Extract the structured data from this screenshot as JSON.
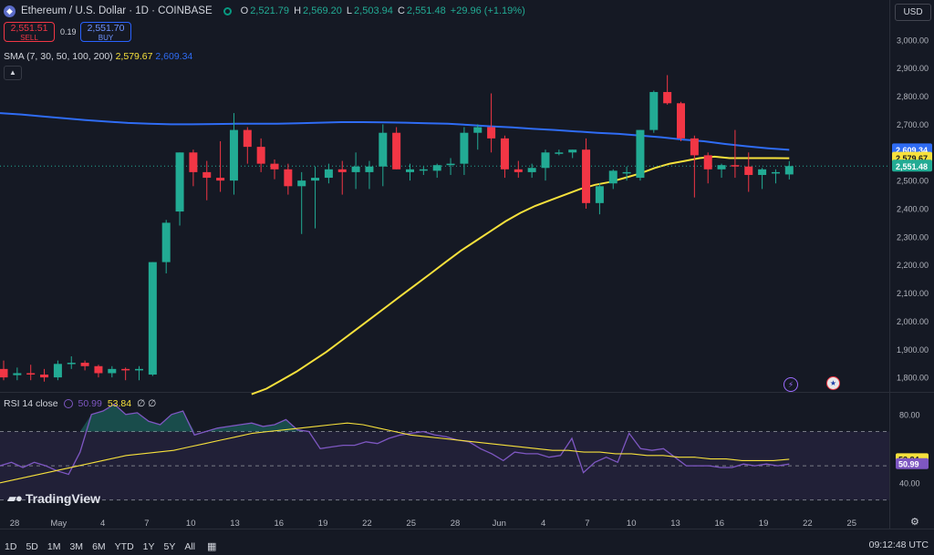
{
  "header": {
    "symbol_title": "Ethereum / U.S. Dollar · 1D · COINBASE",
    "ohlc": [
      {
        "label": "O",
        "value": "2,521.79"
      },
      {
        "label": "H",
        "value": "2,569.20"
      },
      {
        "label": "L",
        "value": "2,503.94"
      },
      {
        "label": "C",
        "value": "2,551.48"
      }
    ],
    "change": "+29.96 (+1.19%)"
  },
  "trade": {
    "sell_price": "2,551.51",
    "sell_label": "SELL",
    "spread": "0.19",
    "buy_price": "2,551.70",
    "buy_label": "BUY"
  },
  "indicator": {
    "sma_label": "SMA (7, 30, 50, 100, 200)",
    "sma_value_yellow": "2,579.67",
    "sma_value_blue": "2,609.34",
    "collapse_icon": "chevron-up-icon"
  },
  "rsi_header": {
    "label": "RSI 14 close",
    "value_purple": "50.99",
    "value_yellow": "53.84",
    "extra": "∅ ∅"
  },
  "currency": "USD",
  "brand": "TradingView",
  "ranges": [
    "1D",
    "5D",
    "1M",
    "3M",
    "6M",
    "YTD",
    "1Y",
    "5Y",
    "All"
  ],
  "clock": "09:12:48 UTC",
  "colors": {
    "up": "#22ab94",
    "down": "#f23645",
    "sma_yellow": "#f7e13c",
    "sma_blue": "#2f6cf4",
    "rsi": "#7e57c2",
    "background": "#151924"
  },
  "chart_data": [
    {
      "type": "candlestick",
      "series": [
        {
          "name": "ETH/USD 1D"
        }
      ],
      "x_tick_labels": [
        "28",
        "May",
        "4",
        "7",
        "10",
        "13",
        "16",
        "19",
        "22",
        "25",
        "28",
        "Jun",
        "4",
        "7",
        "10",
        "13",
        "16",
        "19",
        "22",
        "25"
      ],
      "y_tick_labels": [
        "3,000.00",
        "2,900.00",
        "2,800.00",
        "2,700.00",
        "2,600.00",
        "2,500.00",
        "2,400.00",
        "2,300.00",
        "2,200.00",
        "2,100.00",
        "2,000.00",
        "1,900.00",
        "1,800.00"
      ],
      "ylim": [
        1755,
        3045
      ],
      "candles": [
        {
          "o": 1830,
          "h": 1860,
          "l": 1790,
          "c": 1800
        },
        {
          "o": 1808,
          "h": 1835,
          "l": 1790,
          "c": 1815
        },
        {
          "o": 1815,
          "h": 1845,
          "l": 1790,
          "c": 1810
        },
        {
          "o": 1810,
          "h": 1830,
          "l": 1785,
          "c": 1800
        },
        {
          "o": 1800,
          "h": 1860,
          "l": 1790,
          "c": 1848
        },
        {
          "o": 1848,
          "h": 1875,
          "l": 1830,
          "c": 1852
        },
        {
          "o": 1852,
          "h": 1860,
          "l": 1825,
          "c": 1840
        },
        {
          "o": 1840,
          "h": 1845,
          "l": 1800,
          "c": 1815
        },
        {
          "o": 1815,
          "h": 1840,
          "l": 1800,
          "c": 1830
        },
        {
          "o": 1830,
          "h": 1835,
          "l": 1790,
          "c": 1825
        },
        {
          "o": 1825,
          "h": 1840,
          "l": 1790,
          "c": 1830
        },
        {
          "o": 1810,
          "h": 2210,
          "l": 1805,
          "c": 2210
        },
        {
          "o": 2210,
          "h": 2360,
          "l": 2170,
          "c": 2350
        },
        {
          "o": 2390,
          "h": 2600,
          "l": 2340,
          "c": 2600
        },
        {
          "o": 2600,
          "h": 2610,
          "l": 2480,
          "c": 2530
        },
        {
          "o": 2530,
          "h": 2570,
          "l": 2430,
          "c": 2510
        },
        {
          "o": 2510,
          "h": 2640,
          "l": 2460,
          "c": 2500
        },
        {
          "o": 2500,
          "h": 2740,
          "l": 2450,
          "c": 2680
        },
        {
          "o": 2680,
          "h": 2690,
          "l": 2560,
          "c": 2620
        },
        {
          "o": 2620,
          "h": 2650,
          "l": 2530,
          "c": 2560
        },
        {
          "o": 2560,
          "h": 2575,
          "l": 2505,
          "c": 2540
        },
        {
          "o": 2540,
          "h": 2560,
          "l": 2450,
          "c": 2480
        },
        {
          "o": 2480,
          "h": 2530,
          "l": 2310,
          "c": 2500
        },
        {
          "o": 2500,
          "h": 2550,
          "l": 2330,
          "c": 2510
        },
        {
          "o": 2510,
          "h": 2560,
          "l": 2490,
          "c": 2540
        },
        {
          "o": 2540,
          "h": 2570,
          "l": 2450,
          "c": 2530
        },
        {
          "o": 2530,
          "h": 2600,
          "l": 2470,
          "c": 2550
        },
        {
          "o": 2530,
          "h": 2570,
          "l": 2470,
          "c": 2550
        },
        {
          "o": 2550,
          "h": 2700,
          "l": 2480,
          "c": 2670
        },
        {
          "o": 2670,
          "h": 2690,
          "l": 2540,
          "c": 2540
        },
        {
          "o": 2530,
          "h": 2560,
          "l": 2500,
          "c": 2540
        },
        {
          "o": 2540,
          "h": 2550,
          "l": 2520,
          "c": 2540
        },
        {
          "o": 2535,
          "h": 2560,
          "l": 2510,
          "c": 2555
        },
        {
          "o": 2555,
          "h": 2580,
          "l": 2520,
          "c": 2560
        },
        {
          "o": 2560,
          "h": 2690,
          "l": 2520,
          "c": 2670
        },
        {
          "o": 2670,
          "h": 2700,
          "l": 2610,
          "c": 2690
        },
        {
          "o": 2690,
          "h": 2810,
          "l": 2600,
          "c": 2650
        },
        {
          "o": 2650,
          "h": 2660,
          "l": 2510,
          "c": 2540
        },
        {
          "o": 2540,
          "h": 2570,
          "l": 2510,
          "c": 2530
        },
        {
          "o": 2530,
          "h": 2560,
          "l": 2510,
          "c": 2545
        },
        {
          "o": 2545,
          "h": 2610,
          "l": 2500,
          "c": 2600
        },
        {
          "o": 2600,
          "h": 2610,
          "l": 2590,
          "c": 2600
        },
        {
          "o": 2600,
          "h": 2610,
          "l": 2580,
          "c": 2610
        },
        {
          "o": 2610,
          "h": 2650,
          "l": 2400,
          "c": 2420
        },
        {
          "o": 2420,
          "h": 2490,
          "l": 2380,
          "c": 2480
        },
        {
          "o": 2490,
          "h": 2540,
          "l": 2470,
          "c": 2535
        },
        {
          "o": 2530,
          "h": 2550,
          "l": 2500,
          "c": 2530
        },
        {
          "o": 2510,
          "h": 2680,
          "l": 2500,
          "c": 2680
        },
        {
          "o": 2680,
          "h": 2820,
          "l": 2670,
          "c": 2815
        },
        {
          "o": 2815,
          "h": 2875,
          "l": 2770,
          "c": 2775
        },
        {
          "o": 2775,
          "h": 2780,
          "l": 2640,
          "c": 2650
        },
        {
          "o": 2650,
          "h": 2660,
          "l": 2440,
          "c": 2590
        },
        {
          "o": 2590,
          "h": 2600,
          "l": 2490,
          "c": 2540
        },
        {
          "o": 2540,
          "h": 2560,
          "l": 2510,
          "c": 2555
        },
        {
          "o": 2555,
          "h": 2680,
          "l": 2510,
          "c": 2550
        },
        {
          "o": 2550,
          "h": 2600,
          "l": 2460,
          "c": 2520
        },
        {
          "o": 2520,
          "h": 2545,
          "l": 2470,
          "c": 2540
        },
        {
          "o": 2530,
          "h": 2540,
          "l": 2490,
          "c": 2530
        },
        {
          "o": 2521.79,
          "h": 2569.2,
          "l": 2503.94,
          "c": 2551.48
        }
      ],
      "sma_yellow": [
        1740,
        1760,
        1790,
        1820,
        1855,
        1890,
        1930,
        1970,
        2010,
        2050,
        2090,
        2130,
        2170,
        2210,
        2250,
        2285,
        2320,
        2355,
        2385,
        2410,
        2430,
        2450,
        2470,
        2485,
        2495,
        2510,
        2525,
        2545,
        2560,
        2570,
        2580,
        2585,
        2580,
        2580,
        2580,
        2580,
        2579.67
      ],
      "sma_blue": [
        2740,
        2735,
        2728,
        2722,
        2715,
        2710,
        2705,
        2702,
        2700,
        2700,
        2701,
        2702,
        2702,
        2702,
        2704,
        2706,
        2708,
        2708,
        2707,
        2706,
        2704,
        2702,
        2698,
        2693,
        2689,
        2684,
        2680,
        2675,
        2670,
        2666,
        2660,
        2654,
        2646,
        2640,
        2630,
        2622,
        2615,
        2609.34
      ],
      "last_price_label": "2,551.48"
    },
    {
      "type": "line",
      "series": [
        {
          "name": "RSI 14 close"
        }
      ],
      "y_tick_labels": [
        "80.00",
        "40.00"
      ],
      "ylim": [
        25,
        90
      ],
      "bands": {
        "upper": 70,
        "middle": 50,
        "lower": 30
      },
      "rsi": [
        50,
        52,
        49,
        52,
        50,
        47,
        45,
        58,
        80,
        82,
        86,
        80,
        81,
        76,
        74,
        80,
        82,
        68,
        70,
        72,
        73,
        74,
        75,
        73,
        74,
        77,
        71,
        70,
        60,
        61,
        62,
        62,
        64,
        63,
        66,
        68,
        69,
        70,
        68,
        67,
        65,
        64,
        60,
        57,
        53,
        58,
        57,
        57,
        55,
        56,
        66,
        46,
        52,
        55,
        52,
        69,
        60,
        59,
        60,
        55,
        50,
        50,
        50,
        49,
        49,
        51,
        50,
        51,
        50,
        50.99
      ],
      "ma": [
        40,
        42,
        44,
        46,
        48,
        50,
        52,
        54,
        56,
        57,
        58,
        59,
        61,
        63,
        65,
        67,
        69,
        70,
        71,
        72,
        73,
        74,
        75,
        74,
        72,
        70,
        68,
        67,
        66,
        65,
        64,
        63,
        62,
        61,
        60,
        59,
        59,
        58,
        58,
        57,
        57,
        56,
        56,
        55,
        55,
        54,
        54,
        53,
        53,
        53,
        53.84
      ]
    }
  ]
}
